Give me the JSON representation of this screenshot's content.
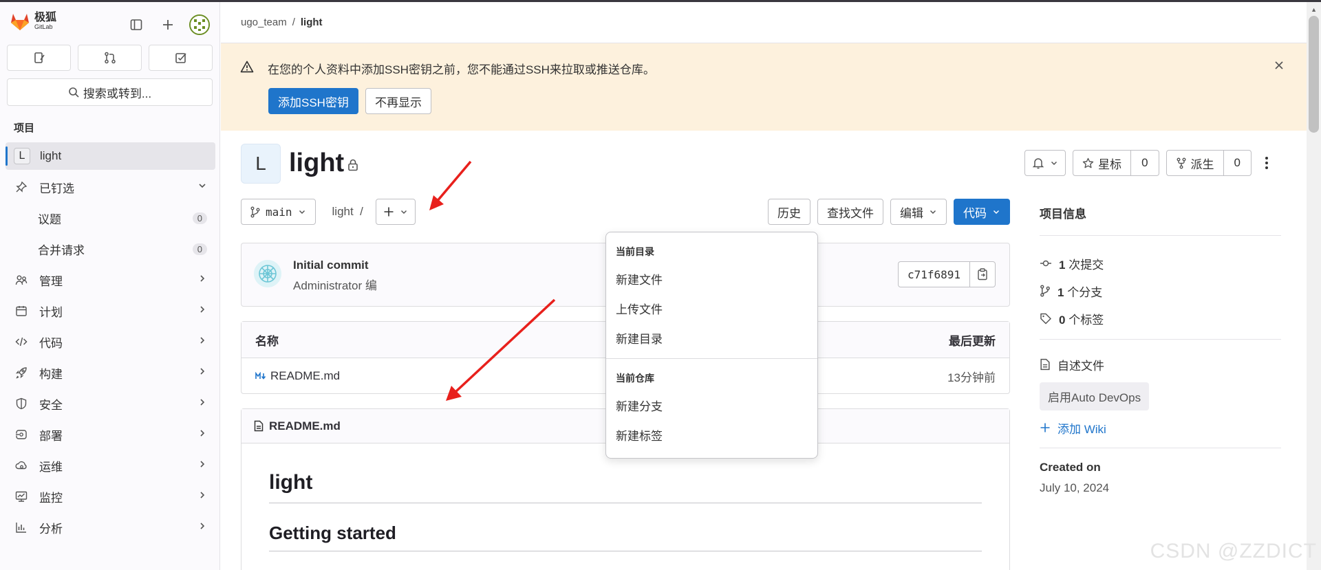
{
  "brand": {
    "name_cn": "极狐",
    "name_en": "GitLab"
  },
  "sidebar": {
    "search_label": "搜索或转到...",
    "section_label": "项目",
    "project": {
      "letter": "L",
      "name": "light"
    },
    "pinned": {
      "label": "已钉选",
      "items": [
        {
          "label": "议题",
          "count": "0"
        },
        {
          "label": "合并请求",
          "count": "0"
        }
      ]
    },
    "items": [
      {
        "label": "管理",
        "icon": "users-icon"
      },
      {
        "label": "计划",
        "icon": "calendar-icon"
      },
      {
        "label": "代码",
        "icon": "code-icon"
      },
      {
        "label": "构建",
        "icon": "rocket-icon"
      },
      {
        "label": "安全",
        "icon": "shield-icon"
      },
      {
        "label": "部署",
        "icon": "deploy-icon"
      },
      {
        "label": "运维",
        "icon": "cloud-gear-icon"
      },
      {
        "label": "监控",
        "icon": "monitor-icon"
      },
      {
        "label": "分析",
        "icon": "chart-icon"
      }
    ]
  },
  "breadcrumb": {
    "group": "ugo_team",
    "sep": "/",
    "current": "light"
  },
  "alert": {
    "message": "在您的个人资料中添加SSH密钥之前，您不能通过SSH来拉取或推送仓库。",
    "primary_btn": "添加SSH密钥",
    "secondary_btn": "不再显示"
  },
  "project": {
    "letter": "L",
    "title": "light",
    "star_label": "星标",
    "star_count": "0",
    "fork_label": "派生",
    "fork_count": "0"
  },
  "repo": {
    "branch": "main",
    "path": "light",
    "path_sep": "/",
    "history": "历史",
    "find_file": "查找文件",
    "edit": "编辑",
    "code": "代码"
  },
  "commit": {
    "title": "Initial commit",
    "author": "Administrator 编",
    "sha": "c71f6891"
  },
  "files": {
    "col_name": "名称",
    "col_updated": "最后更新",
    "rows": [
      {
        "name": "README.md",
        "time": "13分钟前"
      }
    ]
  },
  "readme": {
    "file": "README.md",
    "h1": "light",
    "h2": "Getting started"
  },
  "info": {
    "title": "项目信息",
    "commits_num": "1",
    "commits_label": "次提交",
    "branches_num": "1",
    "branches_label": "个分支",
    "tags_num": "0",
    "tags_label": "个标签",
    "readme_label": "自述文件",
    "autodevops": "启用Auto DevOps",
    "wiki": "添加 Wiki",
    "created_label": "Created on",
    "created_date": "July 10, 2024"
  },
  "dropdown": {
    "group1": "当前目录",
    "group1_items": [
      "新建文件",
      "上传文件",
      "新建目录"
    ],
    "group2": "当前仓库",
    "group2_items": [
      "新建分支",
      "新建标签"
    ]
  },
  "watermark": "CSDN @ZZDICT",
  "colors": {
    "accent": "#1f75cb",
    "alert_bg": "#fdf1dd",
    "arrow": "#e8201c"
  }
}
